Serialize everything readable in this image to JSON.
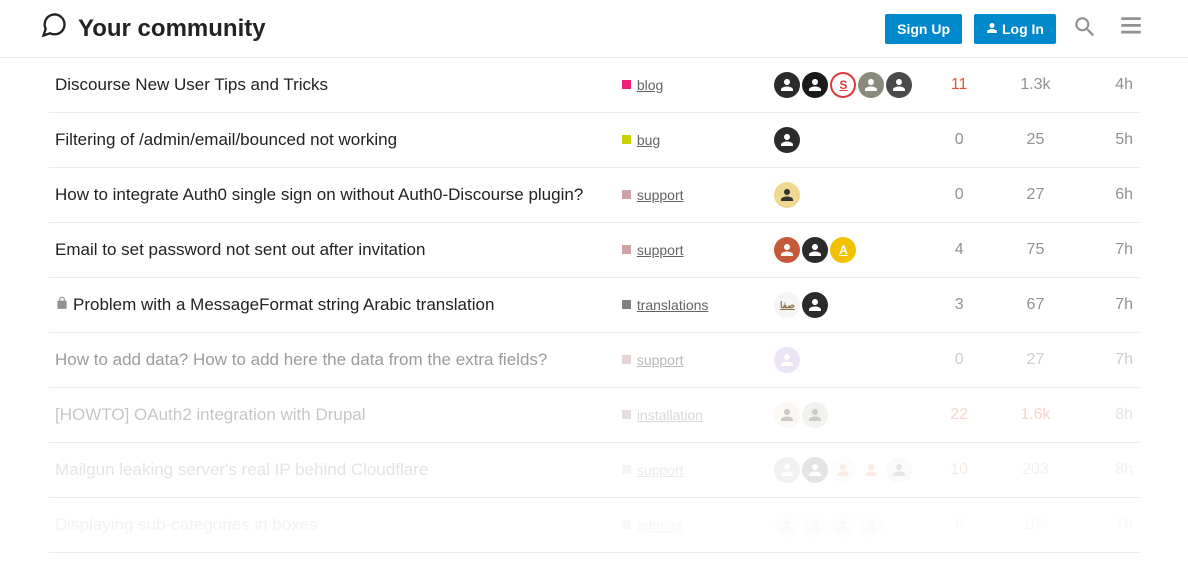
{
  "header": {
    "brand": "Your community",
    "signup": "Sign Up",
    "login": "Log In"
  },
  "categories": {
    "blog": {
      "label": "blog",
      "color": "#ED207B"
    },
    "bug": {
      "label": "bug",
      "color": "#C9CF09"
    },
    "support": {
      "label": "support",
      "color": "#CEA1A4"
    },
    "translations": {
      "label": "translations",
      "color": "#808281"
    },
    "installation": {
      "label": "installation",
      "color": "#997E7E"
    },
    "admins": {
      "label": "admins",
      "color": "#a3a3a3"
    }
  },
  "topics": [
    {
      "title": "Discourse New User Tips and Tricks",
      "locked": false,
      "category": "blog",
      "posters": [
        "user1",
        "user2",
        "user3",
        "user4",
        "user5"
      ],
      "replies": "11",
      "repliesHeat": true,
      "views": "1.3k",
      "viewsHeat": false,
      "activity": "4h",
      "fade": ""
    },
    {
      "title": "Filtering of /admin/email/bounced not working",
      "locked": false,
      "category": "bug",
      "posters": [
        "user1"
      ],
      "replies": "0",
      "repliesHeat": false,
      "views": "25",
      "viewsHeat": false,
      "activity": "5h",
      "fade": ""
    },
    {
      "title": "How to integrate Auth0 single sign on without Auth0-Discourse plugin?",
      "locked": false,
      "category": "support",
      "posters": [
        "user6"
      ],
      "replies": "0",
      "repliesHeat": false,
      "views": "27",
      "viewsHeat": false,
      "activity": "6h",
      "fade": ""
    },
    {
      "title": "Email to set password not sent out after invitation",
      "locked": false,
      "category": "support",
      "posters": [
        "user7",
        "user1",
        "user8"
      ],
      "replies": "4",
      "repliesHeat": false,
      "views": "75",
      "viewsHeat": false,
      "activity": "7h",
      "fade": ""
    },
    {
      "title": "Problem with a MessageFormat string Arabic translation",
      "locked": true,
      "category": "translations",
      "posters": [
        "user9",
        "user1"
      ],
      "replies": "3",
      "repliesHeat": false,
      "views": "67",
      "viewsHeat": false,
      "activity": "7h",
      "fade": ""
    },
    {
      "title": "How to add data? How to add here the data from the extra fields?",
      "locked": false,
      "category": "support",
      "posters": [
        "user10"
      ],
      "replies": "0",
      "repliesHeat": false,
      "views": "27",
      "viewsHeat": false,
      "activity": "7h",
      "fade": "fade1"
    },
    {
      "title": "[HOWTO] OAuth2 integration with Drupal",
      "locked": false,
      "category": "installation",
      "posters": [
        "user11",
        "user12"
      ],
      "replies": "22",
      "repliesHeat": true,
      "views": "1.6k",
      "viewsHeat": true,
      "activity": "8h",
      "fade": "fade2"
    },
    {
      "title": "Mailgun leaking server's real IP behind Cloudflare",
      "locked": false,
      "category": "support",
      "posters": [
        "user13",
        "user1",
        "user14",
        "user15",
        "user16"
      ],
      "replies": "10",
      "repliesHeat": true,
      "views": "203",
      "viewsHeat": false,
      "activity": "8h",
      "fade": "fade3"
    },
    {
      "title": "Displaying sub-categories in boxes",
      "locked": false,
      "category": "admins",
      "posters": [
        "u",
        "u",
        "u",
        "u"
      ],
      "replies": "6",
      "repliesHeat": false,
      "views": "104",
      "viewsHeat": false,
      "activity": "7h",
      "fade": "fade4"
    }
  ],
  "avatarStyles": {
    "user1": {
      "bg": "#2b2b2b",
      "fg": "#fff",
      "txt": ""
    },
    "user2": {
      "bg": "#1a1a1a",
      "fg": "#fff",
      "txt": ""
    },
    "user3": {
      "bg": "#fff",
      "fg": "#e2373c",
      "txt": "S",
      "ring": "#e2373c"
    },
    "user4": {
      "bg": "#8a8a7a",
      "fg": "#fff",
      "txt": ""
    },
    "user5": {
      "bg": "#4a4a4a",
      "fg": "#fff",
      "txt": ""
    },
    "user6": {
      "bg": "#f0d890",
      "fg": "#333",
      "txt": ""
    },
    "user7": {
      "bg": "#c45a3a",
      "fg": "#fff",
      "txt": ""
    },
    "user8": {
      "bg": "#f2c200",
      "fg": "#fff",
      "txt": "A"
    },
    "user9": {
      "bg": "#f5f5f5",
      "fg": "#8a6f4a",
      "txt": "صفا"
    },
    "user10": {
      "bg": "#d4c5e8",
      "fg": "#fff",
      "txt": ""
    },
    "user11": {
      "bg": "#f0e5d5",
      "fg": "#333",
      "txt": ""
    },
    "user12": {
      "bg": "#d5ccc0",
      "fg": "#333",
      "txt": ""
    },
    "user13": {
      "bg": "#919191",
      "fg": "#fff",
      "txt": ""
    },
    "user14": {
      "bg": "#e7e7e7",
      "fg": "#e45735",
      "txt": ""
    },
    "user15": {
      "bg": "#fff",
      "fg": "#e45735",
      "txt": ""
    },
    "user16": {
      "bg": "#ddd",
      "fg": "#333",
      "txt": ""
    },
    "u": {
      "bg": "#e0e0e0",
      "fg": "#999",
      "txt": ""
    }
  }
}
